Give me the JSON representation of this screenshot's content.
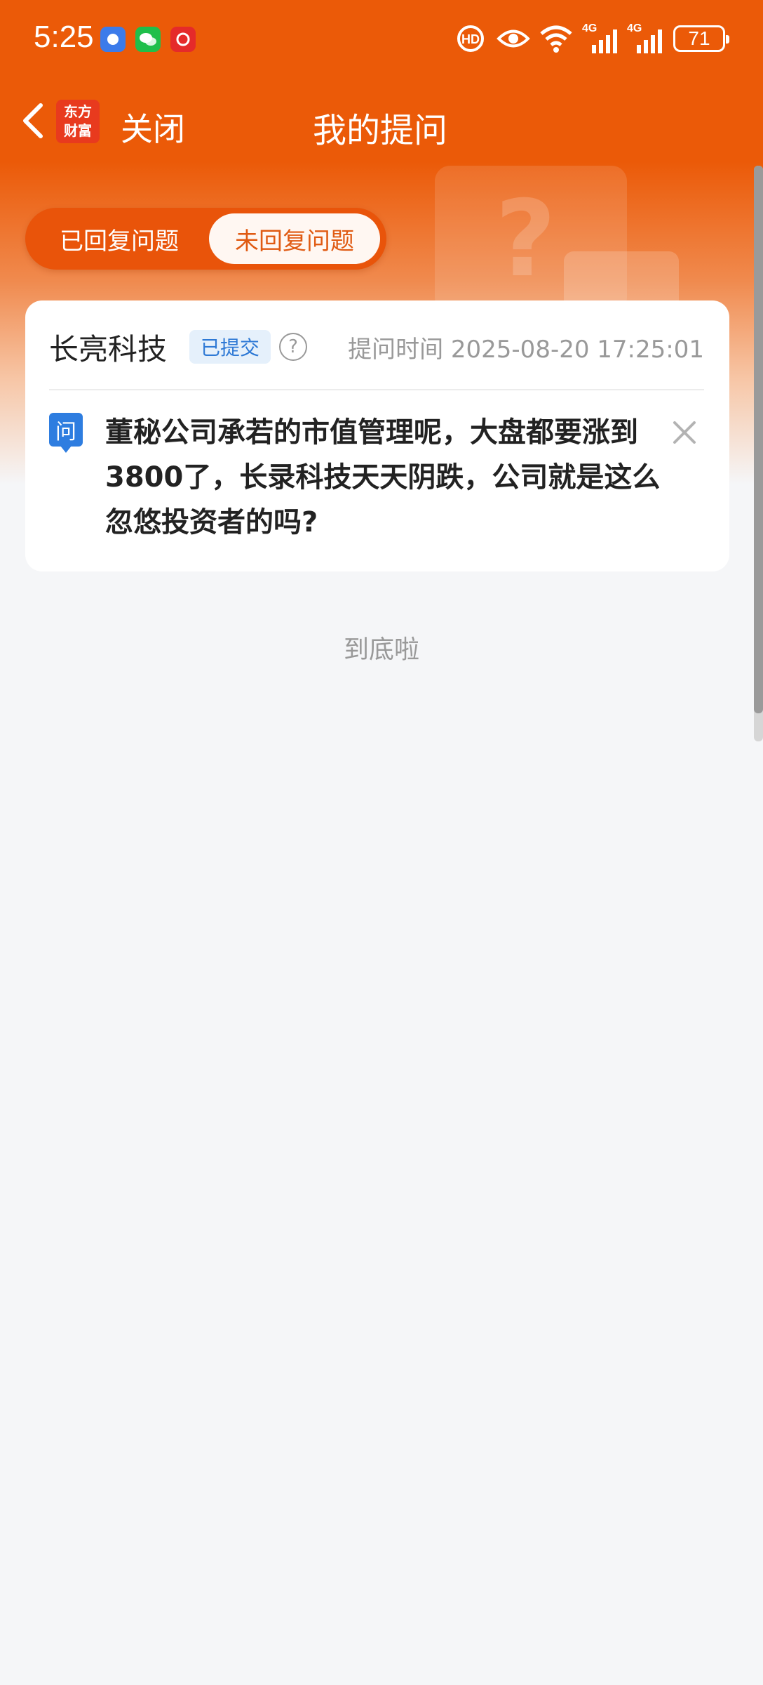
{
  "status_bar": {
    "time": "5:25",
    "battery": "71",
    "network_labels": [
      "4G",
      "4G"
    ],
    "icons": [
      "baidu-icon",
      "wechat-icon",
      "netease-music-icon",
      "hd-call-icon",
      "eye-care-icon",
      "wifi-icon",
      "signal-icon",
      "signal-icon",
      "battery-icon"
    ]
  },
  "nav": {
    "back_icon": "chevron-left-icon",
    "logo_text": [
      "东方",
      "财富"
    ],
    "close_label": "关闭",
    "title": "我的提问"
  },
  "tabs": {
    "answered": "已回复问题",
    "unanswered": "未回复问题",
    "active": "unanswered"
  },
  "question_card": {
    "company": "长亮科技",
    "status_badge": "已提交",
    "help_glyph": "?",
    "time_label": "提问时间 2025-08-20 17:25:01",
    "q_icon_text": "问",
    "question_text": "董秘公司承若的市值管理呢，大盘都要涨到3800了，长录科技天天阴跌，公司就是这么忽悠投资者的吗?"
  },
  "footer": {
    "end_text": "到底啦"
  },
  "colors": {
    "brand_orange": "#eb5a08",
    "badge_blue": "#2e79d5",
    "q_icon_blue": "#2e7de0"
  }
}
